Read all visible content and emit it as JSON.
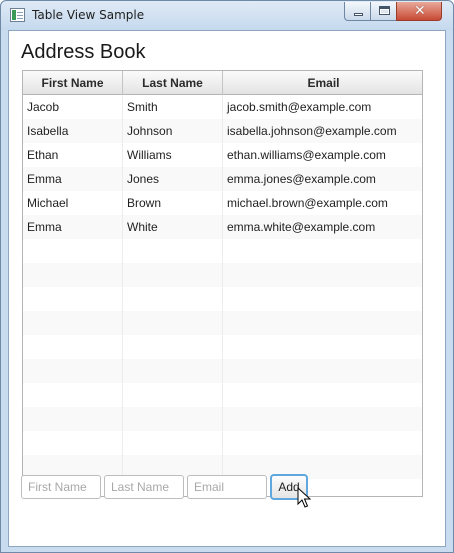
{
  "window": {
    "title": "Table View Sample",
    "icon": "java-app-icon"
  },
  "caption_buttons": {
    "minimize": "minimize-icon",
    "maximize": "maximize-icon",
    "close": "close-icon",
    "close_glyph": "✕"
  },
  "heading": "Address Book",
  "table": {
    "columns": [
      "First Name",
      "Last Name",
      "Email"
    ],
    "rows": [
      {
        "first": "Jacob",
        "last": "Smith",
        "email": "jacob.smith@example.com"
      },
      {
        "first": "Isabella",
        "last": "Johnson",
        "email": "isabella.johnson@example.com"
      },
      {
        "first": "Ethan",
        "last": "Williams",
        "email": "ethan.williams@example.com"
      },
      {
        "first": "Emma",
        "last": "Jones",
        "email": "emma.jones@example.com"
      },
      {
        "first": "Michael",
        "last": "Brown",
        "email": "michael.brown@example.com"
      },
      {
        "first": "Emma",
        "last": "White",
        "email": "emma.white@example.com"
      },
      {
        "first": "",
        "last": "",
        "email": ""
      },
      {
        "first": "",
        "last": "",
        "email": ""
      },
      {
        "first": "",
        "last": "",
        "email": ""
      },
      {
        "first": "",
        "last": "",
        "email": ""
      },
      {
        "first": "",
        "last": "",
        "email": ""
      },
      {
        "first": "",
        "last": "",
        "email": ""
      },
      {
        "first": "",
        "last": "",
        "email": ""
      },
      {
        "first": "",
        "last": "",
        "email": ""
      },
      {
        "first": "",
        "last": "",
        "email": ""
      },
      {
        "first": "",
        "last": "",
        "email": ""
      },
      {
        "first": "",
        "last": "",
        "email": ""
      }
    ]
  },
  "form": {
    "first_name": {
      "value": "",
      "placeholder": "First Name"
    },
    "last_name": {
      "value": "",
      "placeholder": "Last Name"
    },
    "email": {
      "value": "",
      "placeholder": "Email"
    },
    "add_label": "Add"
  },
  "colors": {
    "accent_focus": "#5fa8df",
    "title_bar": "#c9dcef",
    "close_button": "#c74a34"
  }
}
